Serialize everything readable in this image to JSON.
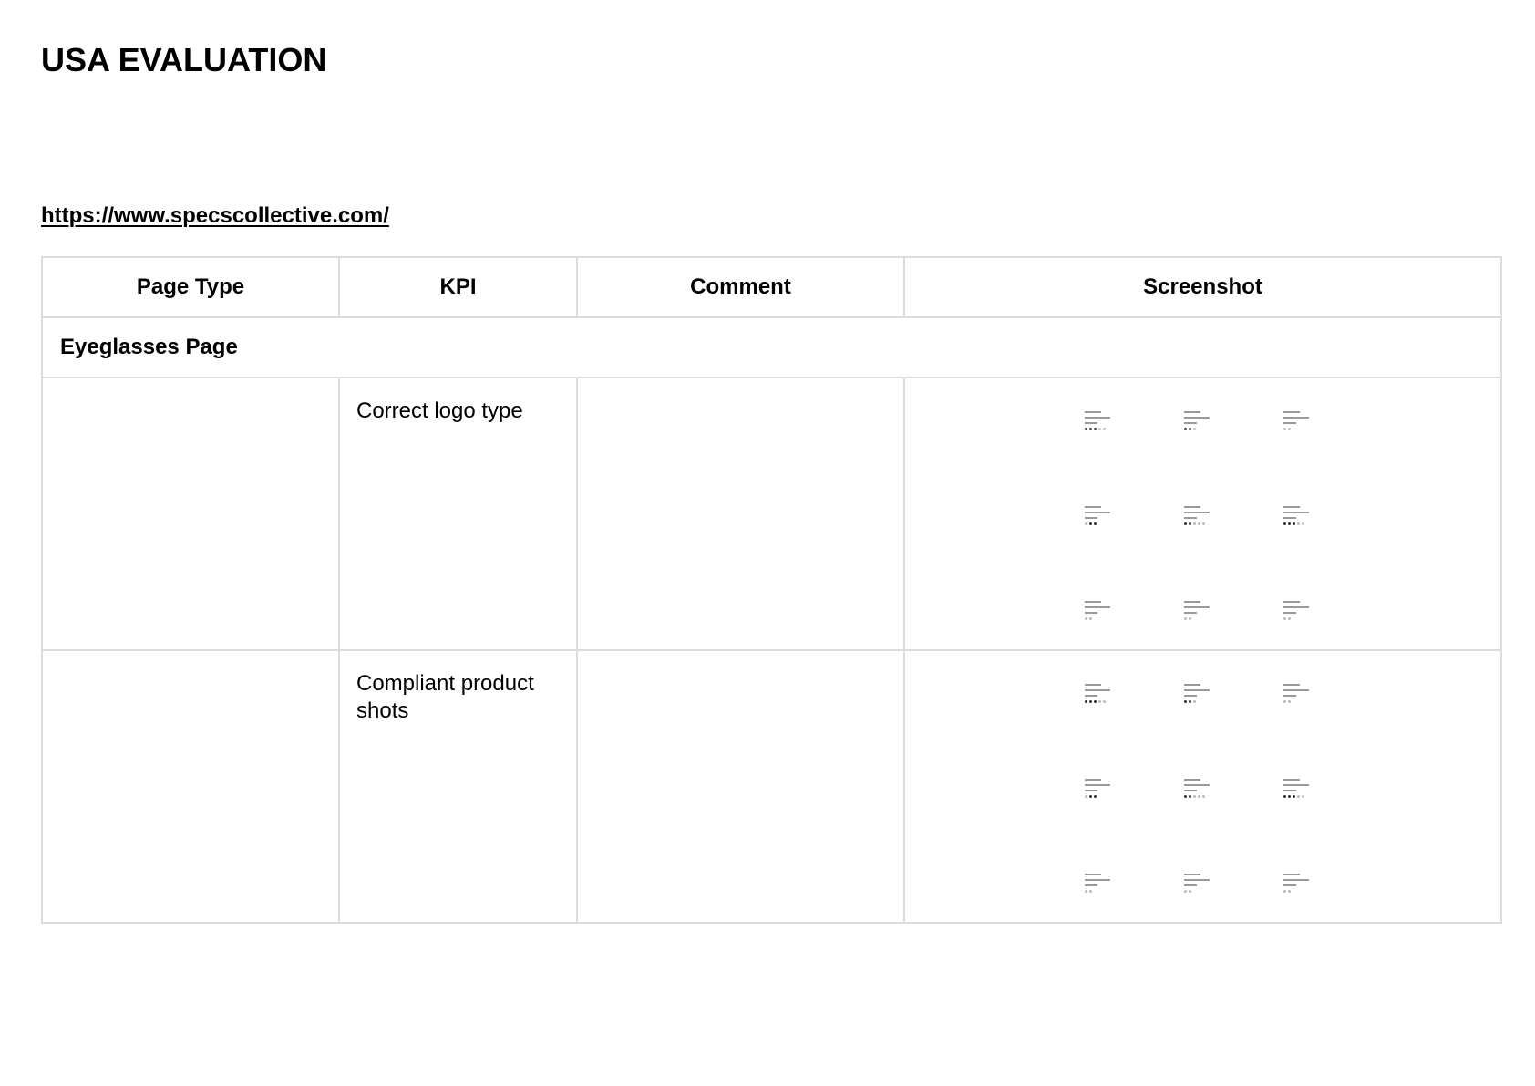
{
  "document": {
    "title": "USA EVALUATION",
    "link": "https://www.specscollective.com/"
  },
  "table": {
    "headers": [
      "Page Type",
      "KPI",
      "Comment",
      "Screenshot"
    ],
    "section": "Eyeglasses Page",
    "rows": [
      {
        "page_type": "",
        "kpi": "Correct logo type",
        "comment": ""
      },
      {
        "page_type": "",
        "kpi": "Compliant product shots",
        "comment": ""
      }
    ]
  },
  "colors": {
    "border": "#dcdcdc",
    "text": "#000000",
    "background": "#ffffff"
  }
}
